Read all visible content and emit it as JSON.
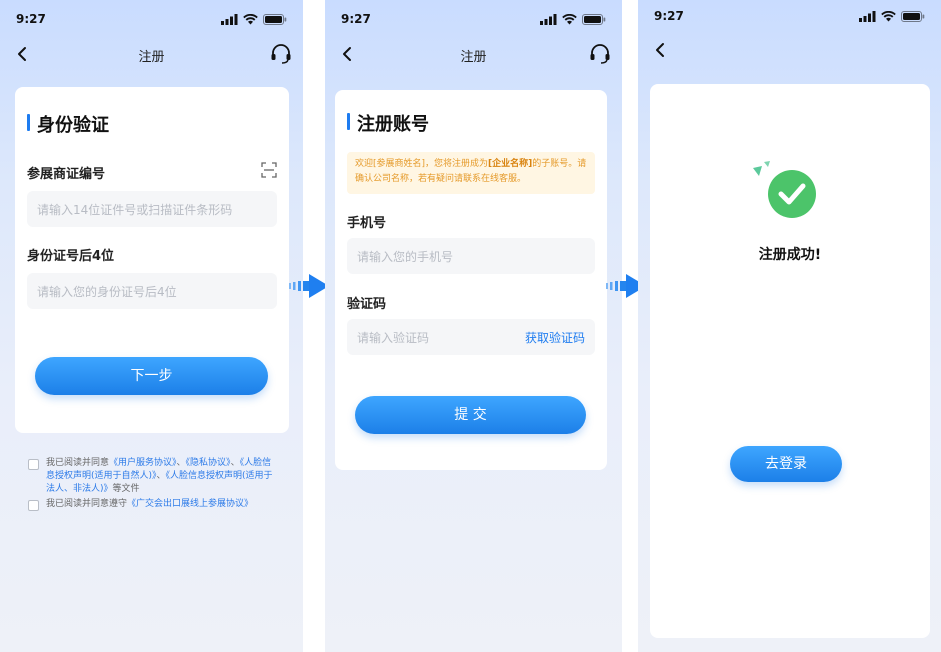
{
  "status_bar": {
    "time": "9:27"
  },
  "screen1": {
    "nav_title": "注册",
    "section_title": "身份验证",
    "exhibitor_label": "参展商证编号",
    "exhibitor_placeholder": "请输入14位证件号或扫描证件条形码",
    "id_label": "身份证号后4位",
    "id_placeholder": "请输入您的身份证号后4位",
    "next_button": "下一步",
    "agreement1": {
      "prefix": "我已阅读并同意",
      "link1": "《用户服务协议》",
      "sep1": "、",
      "link2": "《隐私协议》",
      "sep2": "、",
      "link3": "《人脸信息授权声明(适用于自然人)》",
      "sep3": "、",
      "link4": "《人脸信息授权声明(适用于法人、非法人)》",
      "suffix": "等文件"
    },
    "agreement2": {
      "prefix": "我已阅读并同意遵守",
      "link": "《广交会出口展线上参展协议》"
    }
  },
  "screen2": {
    "nav_title": "注册",
    "section_title": "注册账号",
    "notice_part1": "欢迎[参展商姓名]，您将注册成为",
    "notice_bold": "[企业名称]",
    "notice_part2": "的子账号。请确认公司名称，若有疑问请联系在线客服。",
    "phone_label": "手机号",
    "phone_placeholder": "请输入您的手机号",
    "code_label": "验证码",
    "code_placeholder": "请输入验证码",
    "get_code": "获取验证码",
    "submit_button": "提 交"
  },
  "screen3": {
    "success_text": "注册成功!",
    "login_button": "去登录"
  },
  "colors": {
    "accent": "#1e7cf0",
    "success": "#4cc46a",
    "notice_bg": "#fff6e3",
    "notice_text": "#e59a2a"
  }
}
